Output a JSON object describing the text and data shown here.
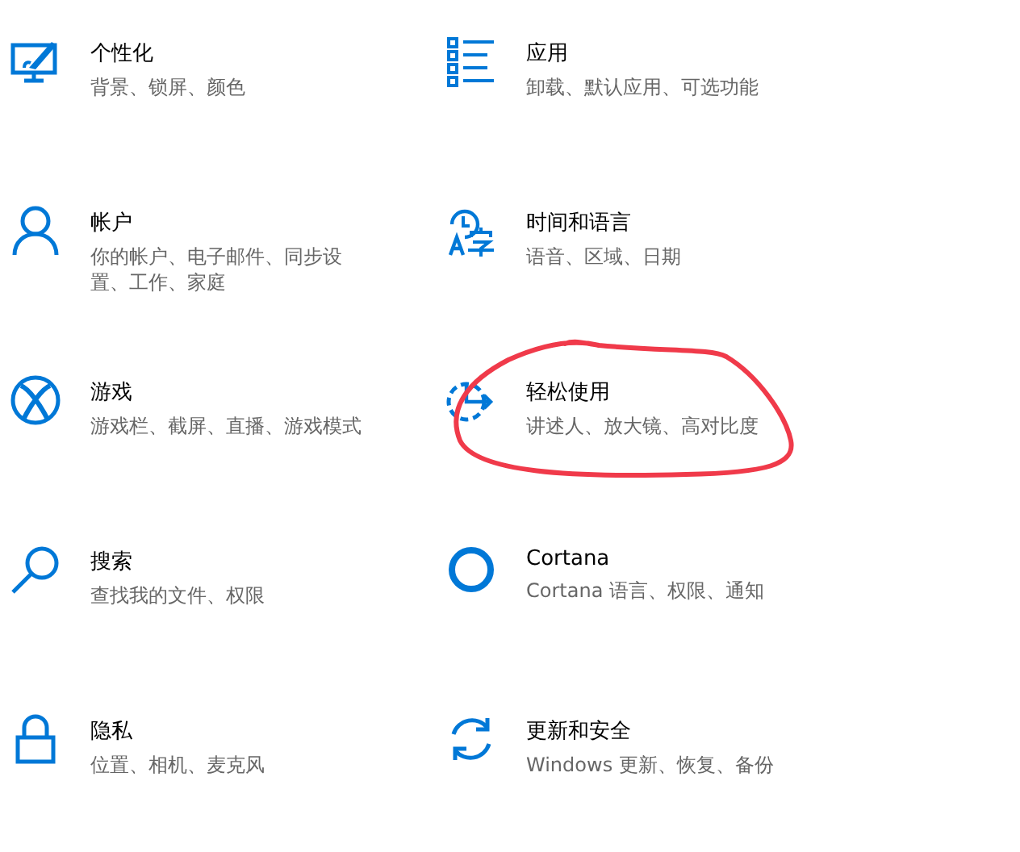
{
  "settings": [
    {
      "title": "个性化",
      "description": "背景、锁屏、颜色",
      "circled": false
    },
    {
      "title": "应用",
      "description": "卸载、默认应用、可选功能",
      "circled": false
    },
    {
      "title": "帐户",
      "description": "你的帐户、电子邮件、同步设置、工作、家庭",
      "circled": false
    },
    {
      "title": "时间和语言",
      "description": "语音、区域、日期",
      "circled": false
    },
    {
      "title": "游戏",
      "description": "游戏栏、截屏、直播、游戏模式",
      "circled": false
    },
    {
      "title": "轻松使用",
      "description": "讲述人、放大镜、高对比度",
      "circled": true
    },
    {
      "title": "搜索",
      "description": "查找我的文件、权限",
      "circled": false
    },
    {
      "title": "Cortana",
      "description": "Cortana 语言、权限、通知",
      "circled": false
    },
    {
      "title": "隐私",
      "description": "位置、相机、麦克风",
      "circled": false
    },
    {
      "title": "更新和安全",
      "description": "Windows 更新、恢复、备份",
      "circled": false
    }
  ]
}
